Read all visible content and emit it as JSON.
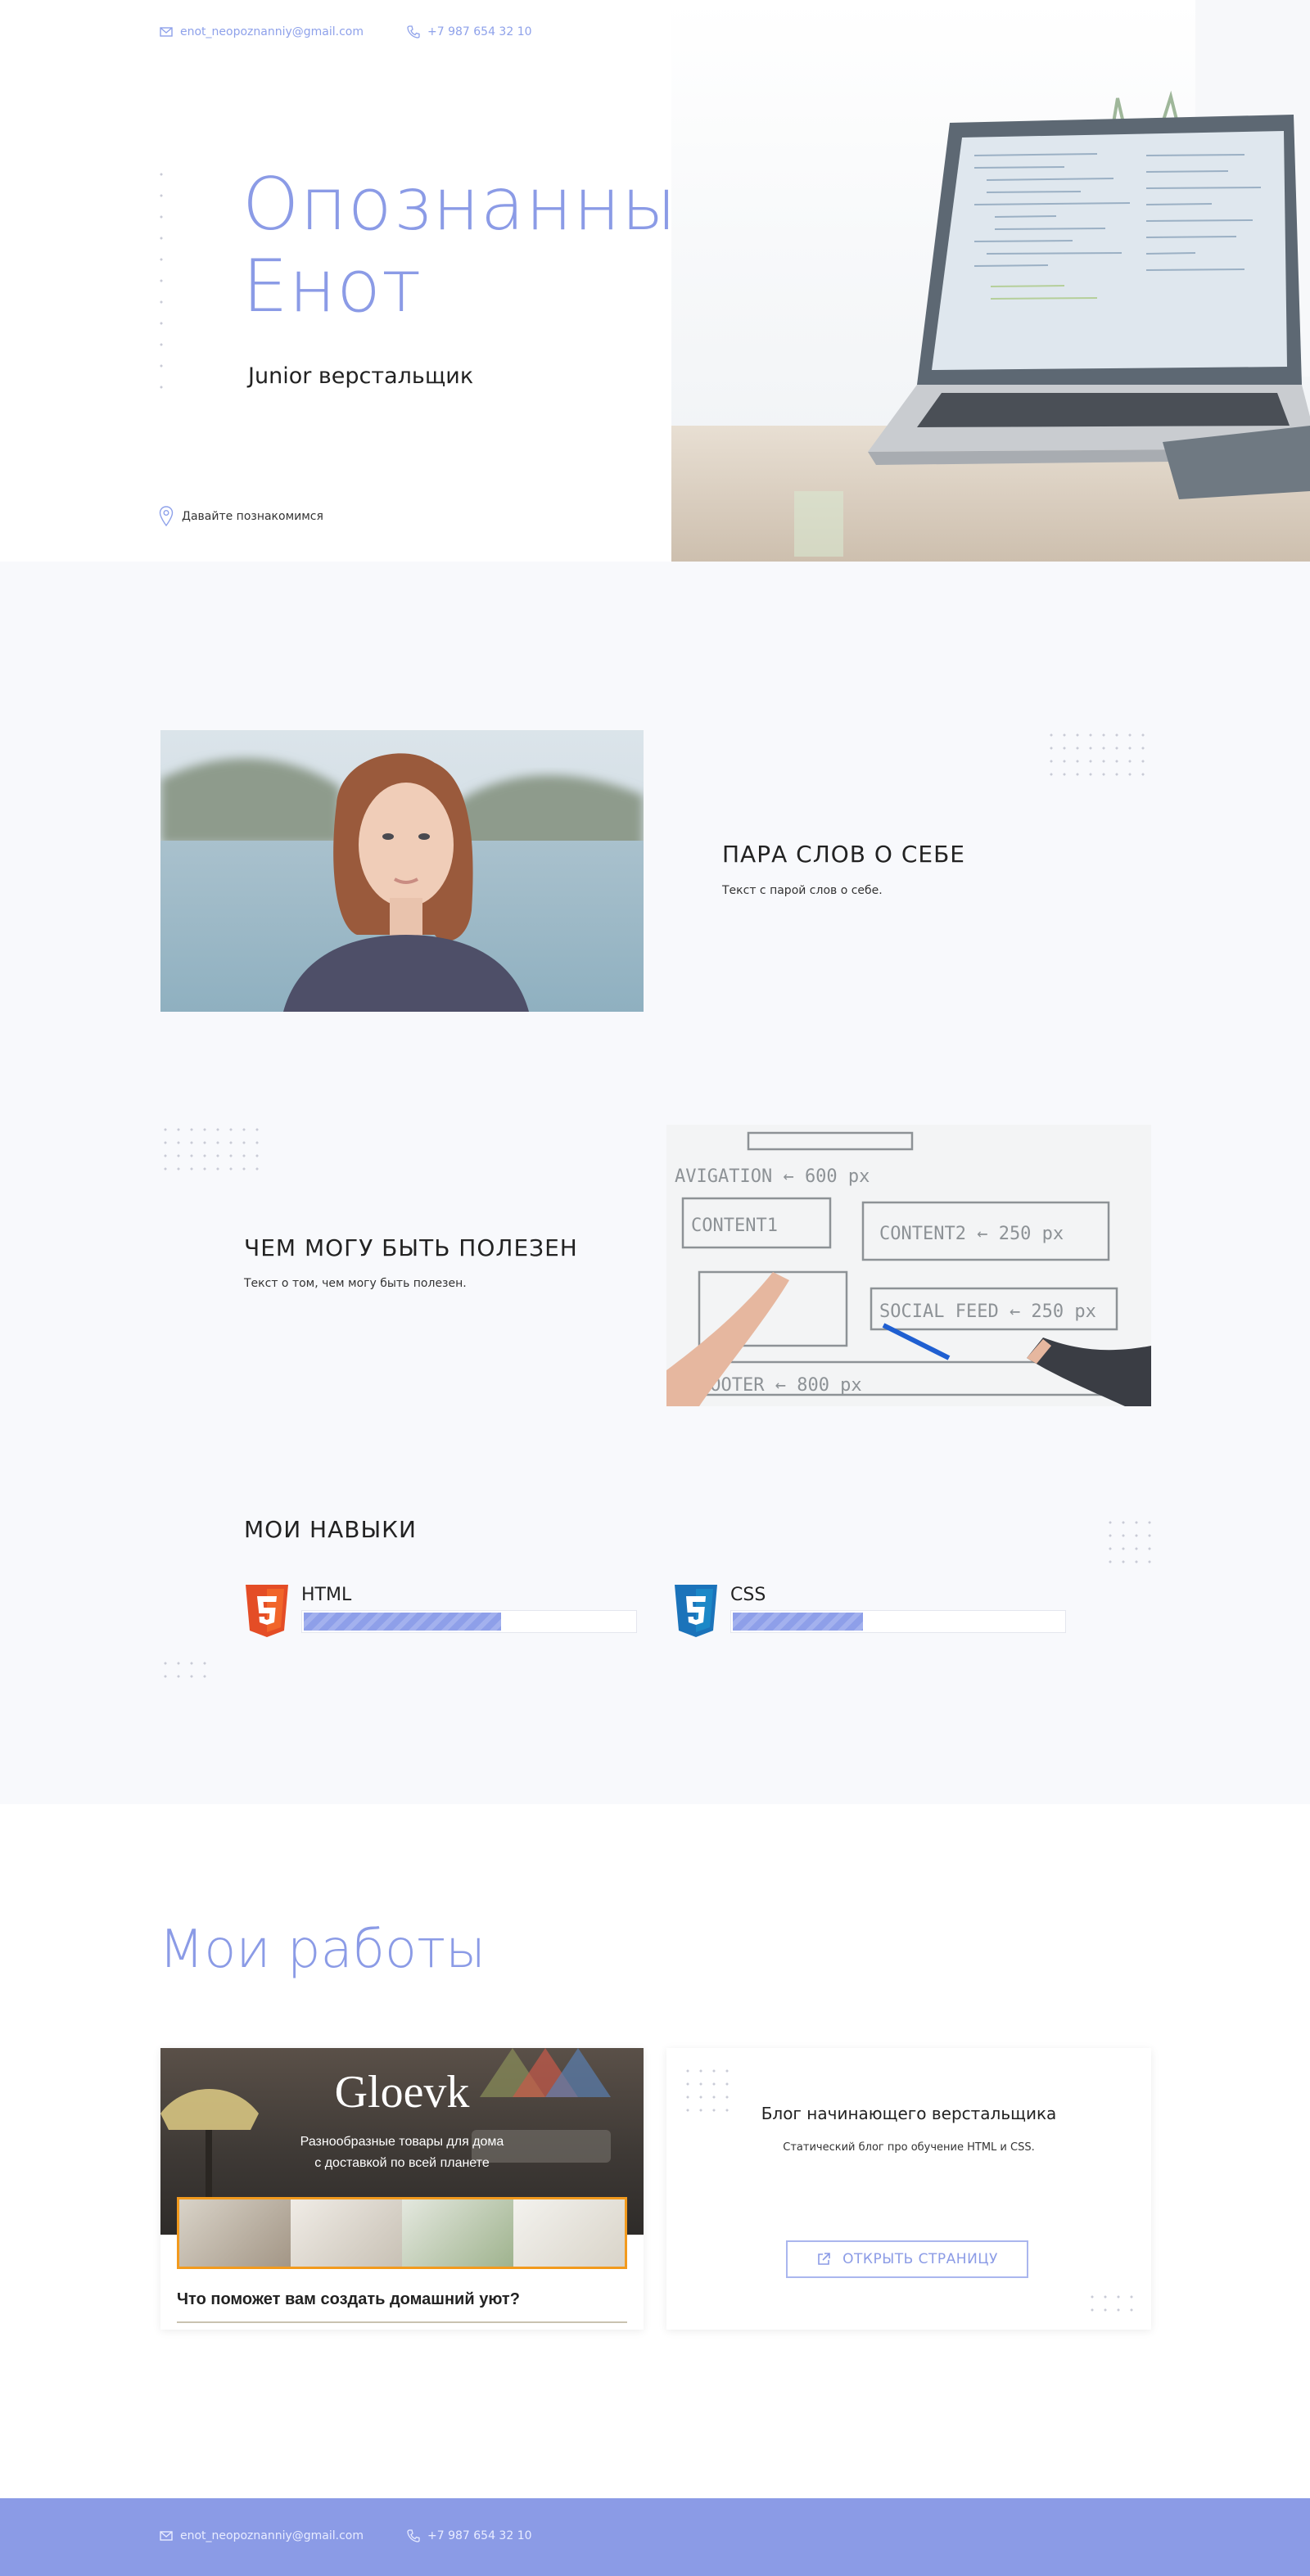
{
  "header": {
    "email": "enot_neopoznanniy@gmail.com",
    "phone": "+7 987 654 32 10",
    "title_line1": "Опознанный",
    "title_line2": "Енот",
    "subtitle": "Junior верстальщик",
    "scroll_hint": "Давайте познакомимся"
  },
  "about": {
    "title": "ПАРА СЛОВ О СЕБЕ",
    "text": "Текст с парой слов о себе."
  },
  "useful": {
    "title": "ЧЕМ МОГУ БЫТЬ ПОЛЕЗЕН",
    "text": "Текст о том, чем могу быть полезен."
  },
  "skills": {
    "title": "МОИ НАВЫКИ",
    "items": [
      {
        "name": "HTML",
        "level": 0.6,
        "icon": "html5-icon",
        "color": "#e44d26"
      },
      {
        "name": "CSS",
        "level": 0.4,
        "icon": "css3-icon",
        "color": "#1b73ba"
      }
    ]
  },
  "works": {
    "title": "Мои работы",
    "card1": {
      "brand": "Gloevk",
      "tagline_line1": "Разнообразные товары для дома",
      "tagline_line2": "с доставкой по всей планете",
      "heading": "Что поможет вам создать домашний уют?"
    },
    "card2": {
      "title": "Блог начинающего верстальщика",
      "text": "Статический блог про обучение HTML и CSS.",
      "button": "ОТКРЫТЬ СТРАНИЦУ"
    }
  },
  "footer": {
    "email": "enot_neopoznanniy@gmail.com",
    "phone": "+7 987 654 32 10"
  },
  "colors": {
    "accent": "#8b9be6",
    "section_bg": "#f8f9fc"
  }
}
